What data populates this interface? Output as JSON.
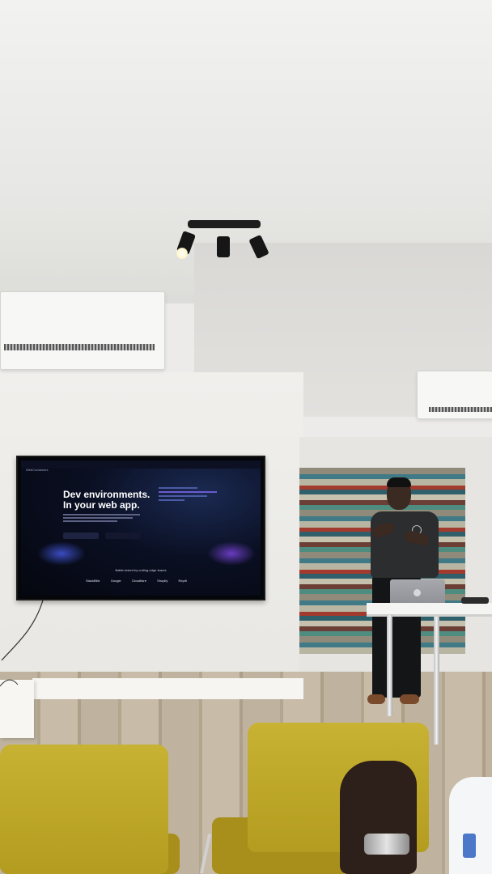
{
  "scene": {
    "tv_screen": {
      "nav_brand": "WebContainers",
      "hero_line1": "Dev environments.",
      "hero_line2": "In your web app.",
      "trusted_text": "Battle-tested by cutting-edge teams",
      "logos": [
        "StackBlitz",
        "Google",
        "Cloudflare",
        "Shopify",
        "Replit"
      ]
    }
  }
}
